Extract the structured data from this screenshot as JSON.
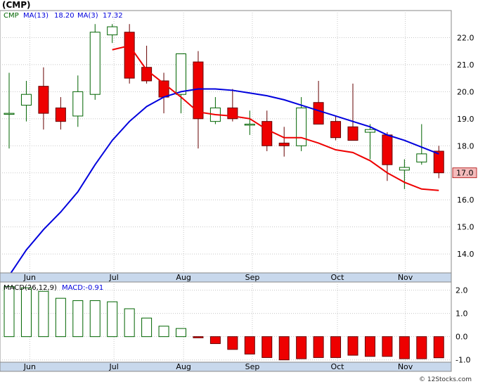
{
  "title": "(CMP)",
  "watermark": "© 12Stocks.com",
  "colors": {
    "up_fill": "#ffffff",
    "up_stroke": "#006400",
    "down_fill": "#ee0000",
    "down_stroke": "#660000",
    "ma_fast": "#ee0000",
    "ma_slow": "#0000dd",
    "axis_band": "#c8d8ec",
    "grid": "#c8c8c8",
    "last_price_box": "#f4bbbb"
  },
  "price_legend": {
    "symbol": "CMP",
    "ma13_label": "MA(13)",
    "ma13_value": "18.20",
    "ma3_label": "MA(3)",
    "ma3_value": "17.32"
  },
  "macd_legend": {
    "label": "MACD(26,12,9)",
    "value_label": "MACD:-0.91"
  },
  "last_price_label": "17.0",
  "chart_data": [
    {
      "type": "candlestick",
      "title": "(CMP)",
      "x_tick_labels": [
        "Jun",
        "Jul",
        "Aug",
        "Sep",
        "Oct",
        "Nov"
      ],
      "x_tick_positions": [
        1.2,
        6.1,
        10.15,
        14.15,
        19.1,
        23.05
      ],
      "y_ticks": [
        14.0,
        15.0,
        16.0,
        17.0,
        18.0,
        19.0,
        20.0,
        21.0,
        22.0
      ],
      "ylim": [
        13.3,
        23.0
      ],
      "grid": true,
      "candles": [
        {
          "o": 19.2,
          "h": 20.7,
          "l": 17.9,
          "c": 19.2
        },
        {
          "o": 19.5,
          "h": 20.4,
          "l": 18.9,
          "c": 19.9
        },
        {
          "o": 20.2,
          "h": 20.9,
          "l": 18.6,
          "c": 19.2
        },
        {
          "o": 19.4,
          "h": 19.8,
          "l": 18.6,
          "c": 18.9
        },
        {
          "o": 19.1,
          "h": 20.6,
          "l": 18.7,
          "c": 20.0
        },
        {
          "o": 19.9,
          "h": 22.5,
          "l": 19.7,
          "c": 22.2
        },
        {
          "o": 22.1,
          "h": 22.5,
          "l": 21.8,
          "c": 22.4
        },
        {
          "o": 22.2,
          "h": 22.5,
          "l": 20.3,
          "c": 20.5
        },
        {
          "o": 20.9,
          "h": 21.7,
          "l": 20.3,
          "c": 20.4
        },
        {
          "o": 20.4,
          "h": 20.7,
          "l": 19.2,
          "c": 19.8
        },
        {
          "o": 19.9,
          "h": 21.4,
          "l": 19.2,
          "c": 21.4
        },
        {
          "o": 21.1,
          "h": 21.5,
          "l": 17.9,
          "c": 19.0
        },
        {
          "o": 18.9,
          "h": 19.8,
          "l": 18.8,
          "c": 19.4
        },
        {
          "o": 19.4,
          "h": 20.1,
          "l": 18.9,
          "c": 19.0
        },
        {
          "o": 18.8,
          "h": 19.3,
          "l": 18.4,
          "c": 18.8
        },
        {
          "o": 18.9,
          "h": 19.3,
          "l": 17.8,
          "c": 18.0
        },
        {
          "o": 18.1,
          "h": 18.7,
          "l": 17.6,
          "c": 18.0
        },
        {
          "o": 18.0,
          "h": 19.8,
          "l": 17.8,
          "c": 19.4
        },
        {
          "o": 19.6,
          "h": 20.4,
          "l": 18.8,
          "c": 18.8
        },
        {
          "o": 18.9,
          "h": 19.1,
          "l": 18.2,
          "c": 18.3
        },
        {
          "o": 18.7,
          "h": 20.3,
          "l": 18.2,
          "c": 18.2
        },
        {
          "o": 18.5,
          "h": 18.8,
          "l": 17.5,
          "c": 18.6
        },
        {
          "o": 18.4,
          "h": 18.5,
          "l": 16.7,
          "c": 17.3
        },
        {
          "o": 17.1,
          "h": 17.5,
          "l": 16.4,
          "c": 17.2
        },
        {
          "o": 17.4,
          "h": 18.8,
          "l": 17.3,
          "c": 17.7
        },
        {
          "o": 17.8,
          "h": 18.0,
          "l": 16.8,
          "c": 17.0
        }
      ],
      "series": [
        {
          "name": "MA(3)",
          "values": [
            null,
            null,
            null,
            null,
            null,
            null,
            null,
            null,
            null,
            null,
            null,
            null,
            null,
            null,
            null,
            null,
            null,
            null,
            null,
            null,
            null,
            null,
            null,
            null,
            null,
            null
          ]
        },
        {
          "name": "MA(13)",
          "values": [
            null,
            null,
            null,
            null,
            null,
            null,
            null,
            null,
            null,
            null,
            null,
            null,
            null,
            null,
            null,
            null,
            null,
            null,
            null,
            null,
            null,
            null,
            null,
            null,
            null,
            null
          ]
        }
      ],
      "ma3": [
        null,
        null,
        null,
        null,
        null,
        null,
        21.55,
        21.7,
        20.8,
        20.3,
        19.8,
        19.25,
        19.15,
        19.1,
        19.0,
        18.6,
        18.3,
        18.3,
        18.1,
        17.85,
        17.75,
        17.45,
        17.0,
        16.65,
        16.4,
        16.35
      ],
      "ma13": [
        13.2,
        14.15,
        14.9,
        15.55,
        16.3,
        17.3,
        18.2,
        18.9,
        19.45,
        19.8,
        20.0,
        20.1,
        20.1,
        20.05,
        19.95,
        19.85,
        19.7,
        19.5,
        19.3,
        19.1,
        18.9,
        18.7,
        18.4,
        18.2,
        17.95,
        17.7
      ],
      "ma3_window": [
        7,
        25
      ],
      "ma13_window": [
        0,
        25
      ]
    },
    {
      "type": "bar",
      "title": "MACD(26,12,9)",
      "y_ticks": [
        -1.0,
        0.0,
        1.0,
        2.0
      ],
      "ylim": [
        -1.1,
        2.35
      ],
      "values": [
        2.15,
        2.1,
        1.95,
        1.65,
        1.55,
        1.55,
        1.5,
        1.2,
        0.8,
        0.45,
        0.35,
        -0.05,
        -0.3,
        -0.55,
        -0.75,
        -0.9,
        -1.0,
        -0.95,
        -0.9,
        -0.9,
        -0.8,
        -0.85,
        -0.85,
        -0.95,
        -0.95,
        -0.91
      ]
    }
  ]
}
